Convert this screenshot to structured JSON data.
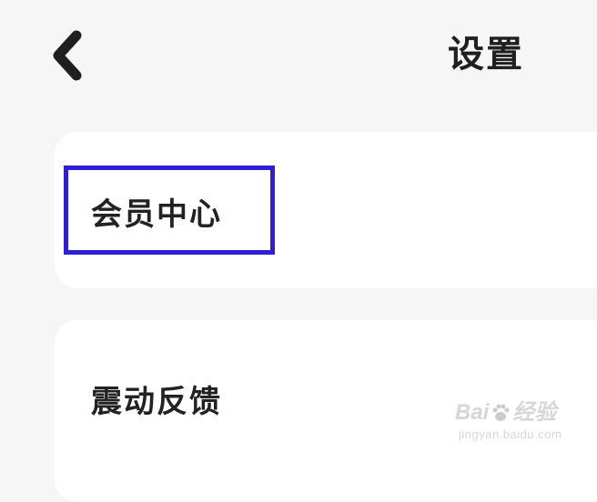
{
  "header": {
    "title": "设置",
    "back_icon": "chevron-left-icon"
  },
  "settings": {
    "items": [
      {
        "label": "会员中心",
        "highlighted": true
      },
      {
        "label": "震动反馈",
        "highlighted": false
      }
    ]
  },
  "watermark": {
    "brand_left": "Bai",
    "brand_right": "经验",
    "url": "jingyan.baidu.com"
  },
  "colors": {
    "background": "#f7f6f7",
    "card": "#ffffff",
    "highlight_border": "#2d1fd6",
    "text": "#222222"
  }
}
